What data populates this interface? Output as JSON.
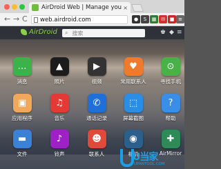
{
  "browser": {
    "tab_title": "AirDroid Web | Manage your p",
    "tab_close": "×",
    "nav": {
      "back": "←",
      "forward": "→",
      "reload": "C"
    },
    "url": "web.airdroid.com",
    "extensions": [
      {
        "icon": "avatar-ext-icon",
        "glyph": "●",
        "color": "#333333"
      },
      {
        "icon": "s-ext-icon",
        "glyph": "S",
        "color": "#444444"
      },
      {
        "icon": "grid-ext-icon",
        "glyph": "▦",
        "color": "#2e7d32"
      },
      {
        "icon": "mail-ext-icon",
        "glyph": "✉",
        "color": "#d32f2f"
      },
      {
        "icon": "red-ext-icon",
        "glyph": "■",
        "color": "#c62828"
      },
      {
        "icon": "menu-icon",
        "glyph": "≡",
        "color": "#666666"
      }
    ]
  },
  "airdroid": {
    "logo": "AirDroid",
    "search_placeholder": "搜索",
    "search_icon": "search-icon",
    "bar_icons": [
      "shirt-icon",
      "bell-icon",
      "menu-icon"
    ],
    "apps": [
      {
        "label": "消息",
        "icon": "messages-icon",
        "glyph": "…",
        "color": "#3cb34a"
      },
      {
        "label": "照片",
        "icon": "photos-icon",
        "glyph": "▲",
        "color": "#1c1c1c"
      },
      {
        "label": "视频",
        "icon": "video-icon",
        "glyph": "▶",
        "color": "#333333"
      },
      {
        "label": "常用联系人",
        "icon": "frequent-contacts-icon",
        "glyph": "♥",
        "color": "#f07a2c"
      },
      {
        "label": "寻找手机",
        "icon": "find-phone-icon",
        "glyph": "⊙",
        "color": "#48b248"
      },
      {
        "label": "应用程序",
        "icon": "apps-icon",
        "glyph": "▣",
        "color": "#f1a85a"
      },
      {
        "label": "音乐",
        "icon": "music-icon",
        "glyph": "♫",
        "color": "#e53935"
      },
      {
        "label": "通话记录",
        "icon": "call-log-icon",
        "glyph": "✆",
        "color": "#1e6fd9"
      },
      {
        "label": "屏幕截图",
        "icon": "screenshot-icon",
        "glyph": "⬚",
        "color": "#2a8ee6"
      },
      {
        "label": "帮助",
        "icon": "help-icon",
        "glyph": "?",
        "color": "#3a8ee8"
      },
      {
        "label": "文件",
        "icon": "files-icon",
        "glyph": "▬",
        "color": "#3b82d6"
      },
      {
        "label": "铃声",
        "icon": "ringtones-icon",
        "glyph": "♪",
        "color": "#a020c8"
      },
      {
        "label": "联系人",
        "icon": "contacts-icon",
        "glyph": "☻",
        "color": "#e04a3a"
      },
      {
        "label": "相机",
        "icon": "camera-icon",
        "glyph": "◉",
        "color": "#2c5f8a"
      },
      {
        "label": "AirMirror",
        "icon": "airmirror-icon",
        "glyph": "✚",
        "color": "#2e8b57"
      }
    ],
    "watermark": {
      "text": "U当家",
      "url": "UPANTOOL.COM"
    }
  }
}
